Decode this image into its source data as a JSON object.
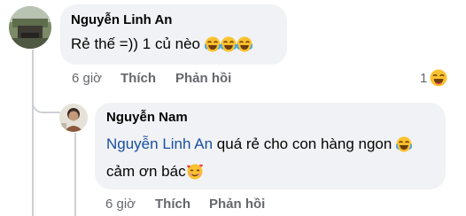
{
  "comment": {
    "author": "Nguyễn Linh An",
    "text": "Rẻ thế =)) 1 củ nèo",
    "time": "6 giờ",
    "like_label": "Thích",
    "reply_label": "Phản hồi",
    "reaction_count": "1"
  },
  "reply": {
    "author": "Nguyễn Nam",
    "mention": "Nguyễn Linh An",
    "text_line1": "quá rẻ cho con hàng ngon",
    "text_line2": "cảm ơn bác",
    "time": "6 giờ",
    "like_label": "Thích",
    "reply_label": "Phản hồi"
  },
  "icons": {
    "laughing": "face-with-tears-of-joy-icon",
    "smiling_hearts": "smiling-face-with-hearts-icon",
    "reaction": "haha-reaction-icon"
  },
  "colors": {
    "bubble": "#f0f2f5",
    "mention": "#1a4fa0",
    "meta": "#65676b",
    "emoji": "#fbc12e"
  }
}
